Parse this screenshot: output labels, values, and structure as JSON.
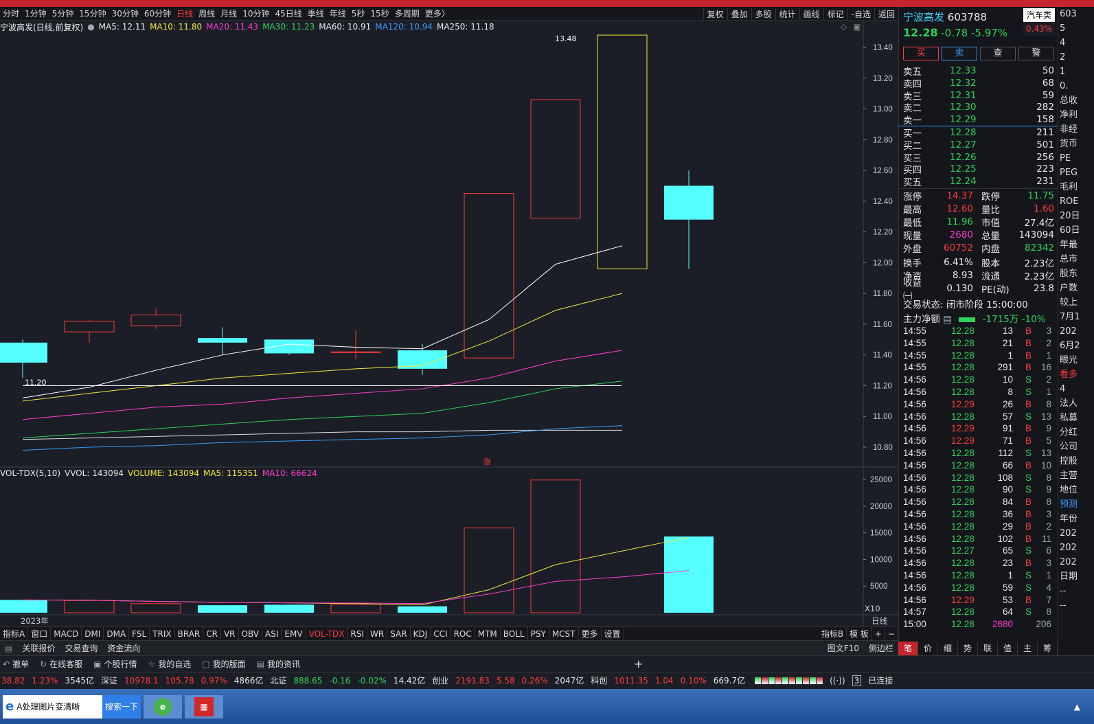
{
  "periods": [
    "分时",
    "1分钟",
    "5分钟",
    "15分钟",
    "30分钟",
    "60分钟",
    "日线",
    "周线",
    "月线",
    "10分钟",
    "45日线",
    "季线",
    "年线",
    "5秒",
    "15秒",
    "多周期",
    "更多〉"
  ],
  "active_period": "日线",
  "toolbar_right": [
    "复权",
    "叠加",
    "多股",
    "统计",
    "画线",
    "标记",
    "-自选",
    "返回"
  ],
  "main_info": {
    "title": "宁波高发(日线,前复权)",
    "ma5": "MA5: 12.11",
    "ma10": "MA10: 11.80",
    "ma20": "MA20: 11.43",
    "ma30": "MA30: 11.23",
    "ma60": "MA60: 10.91",
    "ma120": "MA120: 10.94",
    "ma250": "MA250: 11.18"
  },
  "price_axis": [
    "13.40",
    "13.20",
    "13.00",
    "12.80",
    "12.60",
    "12.40",
    "12.20",
    "12.00",
    "11.80",
    "11.60",
    "11.40",
    "11.20",
    "11.00",
    "10.80"
  ],
  "vol_axis": [
    "25000",
    "20000",
    "15000",
    "10000",
    "5000"
  ],
  "vol_axis_unit": "X10",
  "annotations": {
    "high": "13.48",
    "low": "11.20",
    "zhang": "涨",
    "year": "2023年",
    "period_label": "日线"
  },
  "vol_info": {
    "name": "VOL-TDX(5,10)",
    "vvol": "VVOL: 143094",
    "volume": "VOLUME: 143094",
    "ma5": "MA5: 115351",
    "ma10": "MA10: 66624"
  },
  "chart_data": {
    "type": "candlestick",
    "candles": [
      {
        "o": 11.48,
        "h": 11.5,
        "l": 11.25,
        "c": 11.35
      },
      {
        "o": 11.55,
        "h": 11.63,
        "l": 11.48,
        "c": 11.62
      },
      {
        "o": 11.59,
        "h": 11.7,
        "l": 11.57,
        "c": 11.66
      },
      {
        "o": 11.51,
        "h": 11.58,
        "l": 11.4,
        "c": 11.48
      },
      {
        "o": 11.5,
        "h": 11.5,
        "l": 11.4,
        "c": 11.41
      },
      {
        "o": 11.42,
        "h": 11.56,
        "l": 11.37,
        "c": 11.42
      },
      {
        "o": 11.43,
        "h": 11.47,
        "l": 11.27,
        "c": 11.31
      },
      {
        "o": 11.38,
        "h": 12.45,
        "l": 11.38,
        "c": 12.45
      },
      {
        "o": 12.29,
        "h": 13.06,
        "l": 12.29,
        "c": 13.06
      },
      {
        "o": 11.96,
        "h": 13.48,
        "l": 11.96,
        "c": 13.48
      },
      {
        "o": 12.5,
        "h": 12.6,
        "l": 11.96,
        "c": 12.28
      }
    ],
    "volumes": [
      2400,
      2300,
      1700,
      1400,
      1500,
      1600,
      1200,
      15900,
      24900,
      14300,
      14300
    ],
    "ma5_line": [
      11.12,
      11.19,
      11.3,
      11.4,
      11.47,
      11.45,
      11.44,
      11.63,
      11.99,
      12.11
    ],
    "ma10_line": [
      11.1,
      11.15,
      11.2,
      11.25,
      11.28,
      11.31,
      11.33,
      11.49,
      11.69,
      11.8
    ],
    "ma20_line": [
      10.98,
      11.02,
      11.06,
      11.08,
      11.12,
      11.15,
      11.18,
      11.25,
      11.36,
      11.43
    ],
    "ma30_line": [
      10.86,
      10.89,
      10.92,
      10.95,
      10.98,
      11.0,
      11.02,
      11.09,
      11.18,
      11.23
    ],
    "ma60_line": [
      10.85,
      10.86,
      10.87,
      10.88,
      10.89,
      10.9,
      10.9,
      10.91,
      10.91,
      10.91
    ],
    "ma120_line": [
      10.78,
      10.8,
      10.81,
      10.83,
      10.84,
      10.85,
      10.86,
      10.88,
      10.92,
      10.94
    ]
  },
  "quote": {
    "name": "宁波高发",
    "code": "603788",
    "sector": "汽车类",
    "price": "12.28",
    "change": "-0.78",
    "pct": "-5.97%",
    "extra": "0.43%",
    "buttons": [
      "买",
      "卖",
      "查",
      "警"
    ],
    "sell": [
      [
        "卖五",
        "12.33",
        "50"
      ],
      [
        "卖四",
        "12.32",
        "68"
      ],
      [
        "卖三",
        "12.31",
        "59"
      ],
      [
        "卖二",
        "12.30",
        "282"
      ],
      [
        "卖一",
        "12.29",
        "158"
      ]
    ],
    "buy": [
      [
        "买一",
        "12.28",
        "211"
      ],
      [
        "买二",
        "12.27",
        "501"
      ],
      [
        "买三",
        "12.26",
        "256"
      ],
      [
        "买四",
        "12.25",
        "223"
      ],
      [
        "买五",
        "12.24",
        "231"
      ]
    ],
    "stats": [
      [
        "涨停",
        "14.37",
        "跌停",
        "11.75"
      ],
      [
        "最高",
        "12.60",
        "量比",
        "1.60"
      ],
      [
        "最低",
        "11.96",
        "市值",
        "27.4亿"
      ],
      [
        "现量",
        "2680",
        "总量",
        "143094"
      ],
      [
        "外盘",
        "60752",
        "内盘",
        "82342"
      ],
      [
        "换手",
        "6.41%",
        "股本",
        "2.23亿"
      ],
      [
        "净资",
        "8.93",
        "流通",
        "2.23亿"
      ],
      [
        "收益㈠",
        "0.130",
        "PE(动)",
        "23.8"
      ]
    ],
    "trade_status": "交易状态: 闭市阶段 15:00:00",
    "main_flow_label": "主力净额",
    "main_flow_value": "-1715万 -10%"
  },
  "ticks": [
    [
      "14:55",
      "12.28",
      "13",
      "B",
      "3"
    ],
    [
      "14:55",
      "12.28",
      "21",
      "B",
      "2"
    ],
    [
      "14:55",
      "12.28",
      "1",
      "B",
      "1"
    ],
    [
      "14:55",
      "12.28",
      "291",
      "B",
      "16"
    ],
    [
      "14:56",
      "12.28",
      "10",
      "S",
      "2"
    ],
    [
      "14:56",
      "12.28",
      "8",
      "S",
      "1"
    ],
    [
      "14:56",
      "12.29",
      "26",
      "B",
      "8"
    ],
    [
      "14:56",
      "12.28",
      "57",
      "S",
      "13"
    ],
    [
      "14:56",
      "12.29",
      "91",
      "B",
      "9"
    ],
    [
      "14:56",
      "12.29",
      "71",
      "B",
      "5"
    ],
    [
      "14:56",
      "12.28",
      "112",
      "S",
      "13"
    ],
    [
      "14:56",
      "12.28",
      "66",
      "B",
      "10"
    ],
    [
      "14:56",
      "12.28",
      "108",
      "S",
      "8"
    ],
    [
      "14:56",
      "12.28",
      "90",
      "S",
      "9"
    ],
    [
      "14:56",
      "12.28",
      "84",
      "B",
      "8"
    ],
    [
      "14:56",
      "12.28",
      "36",
      "B",
      "3"
    ],
    [
      "14:56",
      "12.28",
      "29",
      "B",
      "2"
    ],
    [
      "14:56",
      "12.28",
      "102",
      "B",
      "11"
    ],
    [
      "14:56",
      "12.27",
      "65",
      "S",
      "6"
    ],
    [
      "14:56",
      "12.28",
      "23",
      "B",
      "3"
    ],
    [
      "14:56",
      "12.28",
      "1",
      "S",
      "1"
    ],
    [
      "14:56",
      "12.28",
      "59",
      "S",
      "4"
    ],
    [
      "14:56",
      "12.29",
      "53",
      "B",
      "7"
    ],
    [
      "14:57",
      "12.28",
      "64",
      "S",
      "8"
    ],
    [
      "15:00",
      "12.28",
      "2680",
      "",
      "206"
    ]
  ],
  "right_tabs": [
    "笔",
    "价",
    "细",
    "势",
    "联",
    "值",
    "主",
    "筹"
  ],
  "far_right": [
    "603",
    "5",
    "4",
    "2",
    "1",
    "0.",
    "总收",
    "净利",
    "非经",
    "货币",
    "PE",
    "PEG",
    "毛利",
    "ROE",
    "20日",
    "60日",
    "年最",
    "总市",
    "股东",
    "户数",
    "较上",
    "7月1",
    "202",
    "6月2",
    "眼光",
    "看多",
    "4",
    "法人",
    "私募",
    "分红",
    "公司",
    "控股",
    "主营",
    "地位",
    "预测",
    "年份",
    "202",
    "202",
    "202",
    "日期",
    "--",
    "--"
  ],
  "indicators": [
    "指标A",
    "窗口",
    "MACD",
    "DMI",
    "DMA",
    "FSL",
    "TRIX",
    "BRAR",
    "CR",
    "VR",
    "OBV",
    "ASI",
    "EMV",
    "VOL-TDX",
    "RSI",
    "WR",
    "SAR",
    "KDJ",
    "CCI",
    "ROC",
    "MTM",
    "BOLL",
    "PSY",
    "MCST",
    "更多",
    "设置"
  ],
  "active_indicator": "VOL-TDX",
  "indicators_right": [
    "指标B",
    "模 板",
    "+",
    "−"
  ],
  "tabs": [
    "关联报价",
    "交易查询",
    "资金流向"
  ],
  "tabs_right": [
    "图文F10",
    "侧边栏"
  ],
  "tools": [
    "撤单",
    "在线客服",
    "个股行情",
    "我的自选",
    "我的版面",
    "我的资讯"
  ],
  "tools_plus": "+",
  "status": [
    {
      "t": "38.82",
      "c": "red"
    },
    {
      "t": "1.23%",
      "c": "red"
    },
    {
      "t": "3545亿",
      "c": "white"
    },
    {
      "t": "深证",
      "c": "white"
    },
    {
      "t": "10978.1",
      "c": "red"
    },
    {
      "t": "105.78",
      "c": "red"
    },
    {
      "t": "0.97%",
      "c": "red"
    },
    {
      "t": "4866亿",
      "c": "white"
    },
    {
      "t": "北证",
      "c": "white"
    },
    {
      "t": "888.65",
      "c": "green"
    },
    {
      "t": "-0.16",
      "c": "green"
    },
    {
      "t": "-0.02%",
      "c": "green"
    },
    {
      "t": "14.42亿",
      "c": "white"
    },
    {
      "t": "创业",
      "c": "white"
    },
    {
      "t": "2191.83",
      "c": "red"
    },
    {
      "t": "5.58",
      "c": "red"
    },
    {
      "t": "0.26%",
      "c": "red"
    },
    {
      "t": "2047亿",
      "c": "white"
    },
    {
      "t": "科创",
      "c": "white"
    },
    {
      "t": "1011.35",
      "c": "red"
    },
    {
      "t": "1.04",
      "c": "red"
    },
    {
      "t": "0.10%",
      "c": "red"
    },
    {
      "t": "669.7亿",
      "c": "white"
    }
  ],
  "connection": "已连接",
  "connection_count": "3",
  "taskbar": {
    "item1": "A处理图片变清晰",
    "search": "搜索一下"
  }
}
